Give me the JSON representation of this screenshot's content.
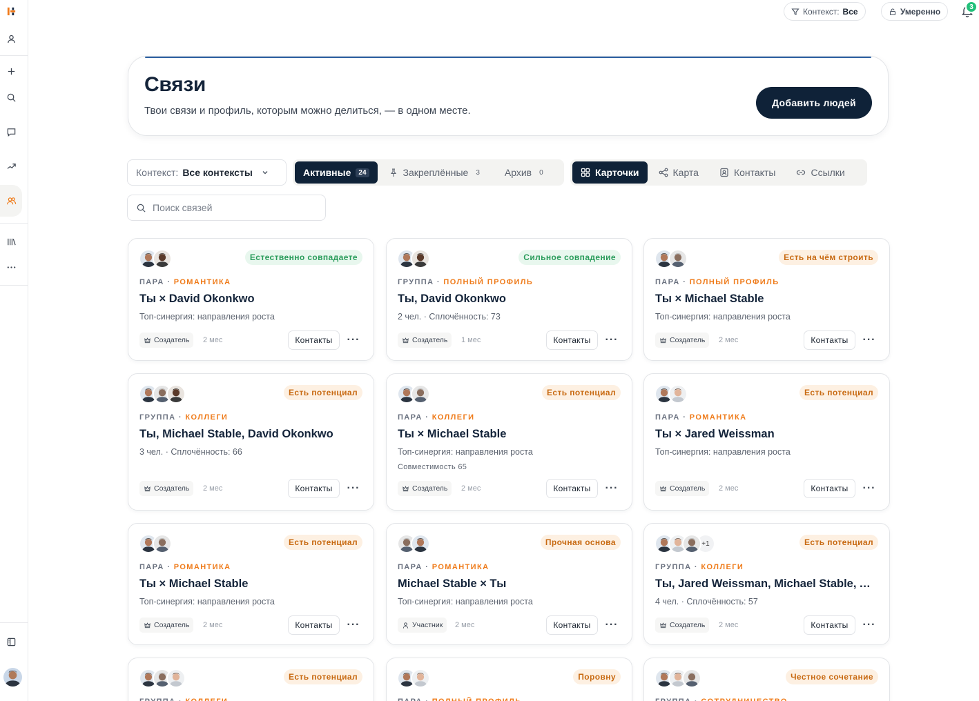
{
  "topbar": {
    "context_label": "Контекст:",
    "context_value": "Все",
    "mode_label": "Умеренно",
    "notifications_count": "3"
  },
  "hero": {
    "title": "Связи",
    "subtitle": "Твои связи и профиль, которым можно делиться, — в одном месте.",
    "add_button": "Добавить людей"
  },
  "toolbar": {
    "context_label": "Контекст:",
    "context_value": "Все контексты",
    "tabs": [
      {
        "label": "Активные",
        "count": "24",
        "active": true
      },
      {
        "label": "Закреплённые",
        "count": "3",
        "active": false
      },
      {
        "label": "Архив",
        "count": "0",
        "active": false
      }
    ],
    "views": [
      {
        "label": "Карточки",
        "active": true
      },
      {
        "label": "Карта",
        "active": false
      },
      {
        "label": "Контакты",
        "active": false
      },
      {
        "label": "Ссылки",
        "active": false
      }
    ],
    "search_placeholder": "Поиск связей"
  },
  "common": {
    "contacts_button": "Контакты",
    "more": "···"
  },
  "cards": [
    {
      "badge": "Естественно совпадаете",
      "badge_color": "green",
      "type": "ПАРА",
      "kind": "РОМАНТИКА",
      "title": "Ты × David Okonkwo",
      "sub": "Топ-синергия: направления роста",
      "sub2": "",
      "role": "Создатель",
      "age": "2 мес",
      "more_avatars": ""
    },
    {
      "badge": "Сильное совпадение",
      "badge_color": "green",
      "type": "ГРУППА",
      "kind": "ПОЛНЫЙ ПРОФИЛЬ",
      "title": "Ты, David Okonkwo",
      "sub": "2 чел. · Сплочённость: 73",
      "sub2": "",
      "role": "Создатель",
      "age": "1 мес",
      "more_avatars": ""
    },
    {
      "badge": "Есть на чём строить",
      "badge_color": "orange",
      "type": "ПАРА",
      "kind": "ПОЛНЫЙ ПРОФИЛЬ",
      "title": "Ты × Michael Stable",
      "sub": "Топ-синергия: направления роста",
      "sub2": "",
      "role": "Создатель",
      "age": "2 мес",
      "more_avatars": ""
    },
    {
      "badge": "Есть потенциал",
      "badge_color": "orange",
      "type": "ГРУППА",
      "kind": "КОЛЛЕГИ",
      "title": "Ты, Michael Stable, David Okonkwo",
      "sub": "3 чел. · Сплочённость: 66",
      "sub2": "",
      "role": "Создатель",
      "age": "2 мес",
      "more_avatars": ""
    },
    {
      "badge": "Есть потенциал",
      "badge_color": "orange",
      "type": "ПАРА",
      "kind": "КОЛЛЕГИ",
      "title": "Ты × Michael Stable",
      "sub": "Топ-синергия: направления роста",
      "sub2": "Совместимость 65",
      "role": "Создатель",
      "age": "2 мес",
      "more_avatars": ""
    },
    {
      "badge": "Есть потенциал",
      "badge_color": "orange",
      "type": "ПАРА",
      "kind": "РОМАНТИКА",
      "title": "Ты × Jared Weissman",
      "sub": "Топ-синергия: направления роста",
      "sub2": "",
      "role": "Создатель",
      "age": "2 мес",
      "more_avatars": ""
    },
    {
      "badge": "Есть потенциал",
      "badge_color": "orange",
      "type": "ПАРА",
      "kind": "РОМАНТИКА",
      "title": "Ты × Michael Stable",
      "sub": "Топ-синергия: направления роста",
      "sub2": "",
      "role": "Создатель",
      "age": "2 мес",
      "more_avatars": ""
    },
    {
      "badge": "Прочная основа",
      "badge_color": "orange",
      "type": "ПАРА",
      "kind": "РОМАНТИКА",
      "title": "Michael Stable × Ты",
      "sub": "Топ-синергия: направления роста",
      "sub2": "",
      "role": "Участник",
      "age": "2 мес",
      "more_avatars": ""
    },
    {
      "badge": "Есть потенциал",
      "badge_color": "orange",
      "type": "ГРУППА",
      "kind": "КОЛЛЕГИ",
      "title": "Ты, Jared Weissman, Michael Stable, A…",
      "sub": "4 чел. · Сплочённость: 57",
      "sub2": "",
      "role": "Создатель",
      "age": "2 мес",
      "more_avatars": "+1"
    },
    {
      "badge": "Есть потенциал",
      "badge_color": "orange",
      "type": "ГРУППА",
      "kind": "КОЛЛЕГИ",
      "title": "",
      "sub": "",
      "sub2": "",
      "role": "",
      "age": "",
      "more_avatars": ""
    },
    {
      "badge": "Поровну",
      "badge_color": "orange",
      "type": "ПАРА",
      "kind": "ПОЛНЫЙ ПРОФИЛЬ",
      "title": "",
      "sub": "",
      "sub2": "",
      "role": "",
      "age": "",
      "more_avatars": ""
    },
    {
      "badge": "Честное сочетание",
      "badge_color": "orange",
      "type": "ГРУППА",
      "kind": "СОТРУДНИЧЕСТВО",
      "title": "",
      "sub": "",
      "sub2": "",
      "role": "",
      "age": "",
      "more_avatars": ""
    }
  ]
}
